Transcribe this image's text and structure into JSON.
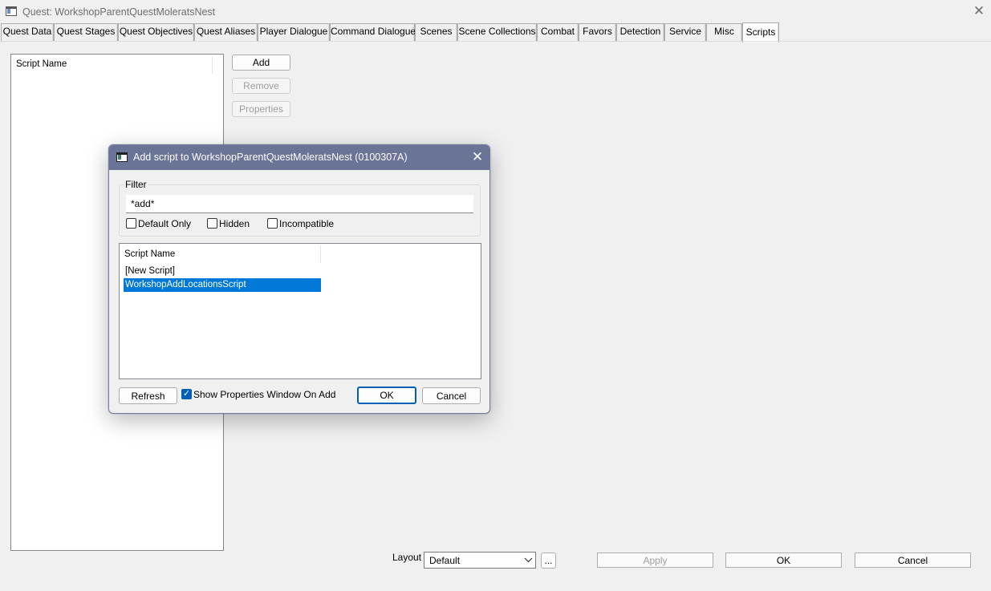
{
  "window": {
    "title": "Quest: WorkshopParentQuestMoleratsNest",
    "close_glyph": "✕"
  },
  "tabs": [
    {
      "label": "Quest Data"
    },
    {
      "label": "Quest Stages"
    },
    {
      "label": "Quest Objectives"
    },
    {
      "label": "Quest Aliases"
    },
    {
      "label": "Player Dialogue"
    },
    {
      "label": "Command Dialogue"
    },
    {
      "label": "Scenes"
    },
    {
      "label": "Scene Collections"
    },
    {
      "label": "Combat"
    },
    {
      "label": "Favors"
    },
    {
      "label": "Detection"
    },
    {
      "label": "Service"
    },
    {
      "label": "Misc"
    },
    {
      "label": "Scripts",
      "active": true
    }
  ],
  "scripts_panel": {
    "column_header": "Script Name",
    "add_label": "Add",
    "remove_label": "Remove",
    "properties_label": "Properties"
  },
  "footer": {
    "layout_label": "Layout",
    "layout_value": "Default",
    "ellipsis_label": "...",
    "apply_label": "Apply",
    "ok_label": "OK",
    "cancel_label": "Cancel"
  },
  "dialog": {
    "title": "Add script to WorkshopParentQuestMoleratsNest (0100307A)",
    "close_glyph": "✕",
    "filter": {
      "legend": "Filter",
      "value": "*add*",
      "checkboxes": [
        {
          "label": "Default Only",
          "checked": false
        },
        {
          "label": "Hidden",
          "checked": false
        },
        {
          "label": "Incompatible",
          "checked": false
        }
      ]
    },
    "list": {
      "column_header": "Script Name",
      "rows": [
        {
          "label": "[New Script]",
          "selected": false
        },
        {
          "label": "WorkshopAddLocationsScript",
          "selected": true
        }
      ]
    },
    "refresh_label": "Refresh",
    "show_properties_label": "Show Properties Window On Add",
    "show_properties_checked": true,
    "ok_label": "OK",
    "cancel_label": "Cancel"
  },
  "colors": {
    "selection": "#0078d7",
    "dialog_titlebar": "#6a7497",
    "primary_border": "#005fb8"
  }
}
